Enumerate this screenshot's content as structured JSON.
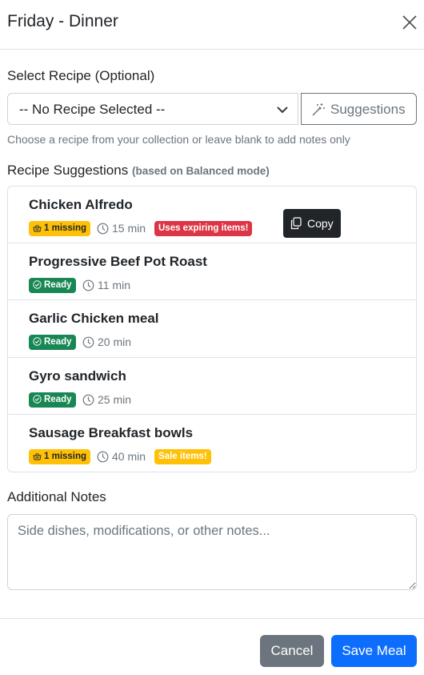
{
  "modal": {
    "title": "Friday - Dinner"
  },
  "recipe_select": {
    "label": "Select Recipe (Optional)",
    "selected": "-- No Recipe Selected --",
    "suggestions_button": "Suggestions",
    "help_text": "Choose a recipe from your collection or leave blank to add notes only"
  },
  "suggestions": {
    "heading": "Recipe Suggestions",
    "mode_note": "(based on Balanced mode)",
    "items": [
      {
        "title": "Chicken Alfredo",
        "status": "1 missing",
        "time": "15 min",
        "tag": "Uses expiring items!"
      },
      {
        "title": "Progressive Beef Pot Roast",
        "status": "Ready",
        "time": "11 min",
        "tag": ""
      },
      {
        "title": "Garlic Chicken meal",
        "status": "Ready",
        "time": "20 min",
        "tag": ""
      },
      {
        "title": "Gyro sandwich",
        "status": "Ready",
        "time": "25 min",
        "tag": ""
      },
      {
        "title": "Sausage Breakfast bowls",
        "status": "1 missing",
        "time": "40 min",
        "tag": "Sale items!"
      }
    ]
  },
  "tooltip": {
    "copy_label": "Copy"
  },
  "notes": {
    "label": "Additional Notes",
    "placeholder": "Side dishes, modifications, or other notes..."
  },
  "footer": {
    "cancel_label": "Cancel",
    "save_label": "Save Meal"
  },
  "colors": {
    "primary": "#0d6efd",
    "secondary": "#6c757d",
    "success": "#198754",
    "warning": "#ffc107",
    "danger": "#dc3545"
  },
  "icons": {
    "close": "close-icon",
    "chevron": "chevron-down-icon",
    "suggestions": "magic-wand-icon",
    "missing": "basket-icon",
    "ready": "check-circle-icon",
    "time": "clock-icon",
    "copy": "copy-icon"
  }
}
